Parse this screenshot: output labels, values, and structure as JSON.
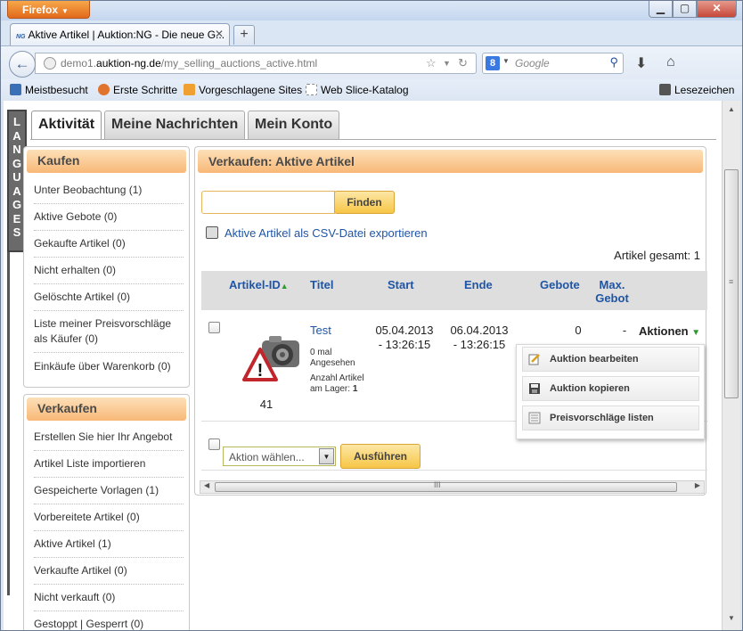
{
  "browser": {
    "app_button": "Firefox",
    "tab_title": "Aktive Artikel | Auktion:NG - Die neue G...",
    "tab_favicon": "NG",
    "url_prefix": "demo1.",
    "url_domain": "auktion-ng.de",
    "url_path": "/my_selling_auctions_active.html",
    "search_placeholder": "Google",
    "search_engine_icon": "8"
  },
  "bookmarks": [
    {
      "label": "Meistbesucht",
      "icon": "bookmark-folder-icon",
      "color": "#3b6fb6"
    },
    {
      "label": "Erste Schritte",
      "icon": "firefox-icon",
      "color": "#e0742c"
    },
    {
      "label": "Vorgeschlagene Sites",
      "icon": "suggested-sites-icon",
      "color": "#f0a030"
    },
    {
      "label": "Web Slice-Katalog",
      "icon": "web-slice-icon",
      "color": "#cccccc"
    },
    {
      "label": "Lesezeichen",
      "icon": "bookmarks-menu-icon",
      "color": "#555555"
    }
  ],
  "languages_label": [
    "L",
    "A",
    "N",
    "G",
    "U",
    "A",
    "G",
    "E",
    "S"
  ],
  "main_tabs": [
    {
      "label": "Aktivität",
      "active": true
    },
    {
      "label": "Meine Nachrichten",
      "active": false
    },
    {
      "label": "Mein Konto",
      "active": false
    }
  ],
  "kaufen": {
    "title": "Kaufen",
    "items": [
      "Unter Beobachtung (1)",
      "Aktive Gebote (0)",
      "Gekaufte Artikel (0)",
      "Nicht erhalten (0)",
      "Gelöschte Artikel (0)",
      "Liste meiner Preisvorschläge als Käufer (0)",
      "Einkäufe über Warenkorb (0)"
    ]
  },
  "verkaufen": {
    "title": "Verkaufen",
    "items": [
      "Erstellen Sie hier Ihr Angebot",
      "Artikel Liste importieren",
      "Gespeicherte Vorlagen (1)",
      "Vorbereitete Artikel (0)",
      "Aktive Artikel (1)",
      "Verkaufte Artikel (0)",
      "Nicht verkauft (0)",
      "Gestoppt | Gesperrt (0)"
    ]
  },
  "main": {
    "title": "Verkaufen: Aktive Artikel",
    "search_value": "",
    "search_button": "Finden",
    "csv_link": "Aktive Artikel als CSV-Datei exportieren",
    "total": "Artikel gesamt: 1",
    "columns": {
      "id": "Artikel-ID",
      "title": "Titel",
      "start": "Start",
      "end": "Ende",
      "bids": "Gebote",
      "max_bid_1": "Max.",
      "max_bid_2": "Gebot"
    },
    "row": {
      "id": "41",
      "title": "Test",
      "start_date": "05.04.2013",
      "start_time": "- 13:26:15",
      "end_date": "06.04.2013",
      "end_time": "- 13:26:15",
      "bids": "0",
      "max_bid": "-",
      "views": "0 mal Angesehen",
      "stock_label": "Anzahl Artikel am Lager:",
      "stock_value": "1",
      "actions_label": "Aktionen"
    },
    "dropdown": [
      {
        "label": "Auktion bearbeiten",
        "icon": "edit-icon"
      },
      {
        "label": "Auktion kopieren",
        "icon": "copy-icon"
      },
      {
        "label": "Preisvorschläge listen",
        "icon": "list-icon"
      }
    ],
    "bulk_select_value": "Aktion wählen...",
    "bulk_button": "Ausführen"
  }
}
